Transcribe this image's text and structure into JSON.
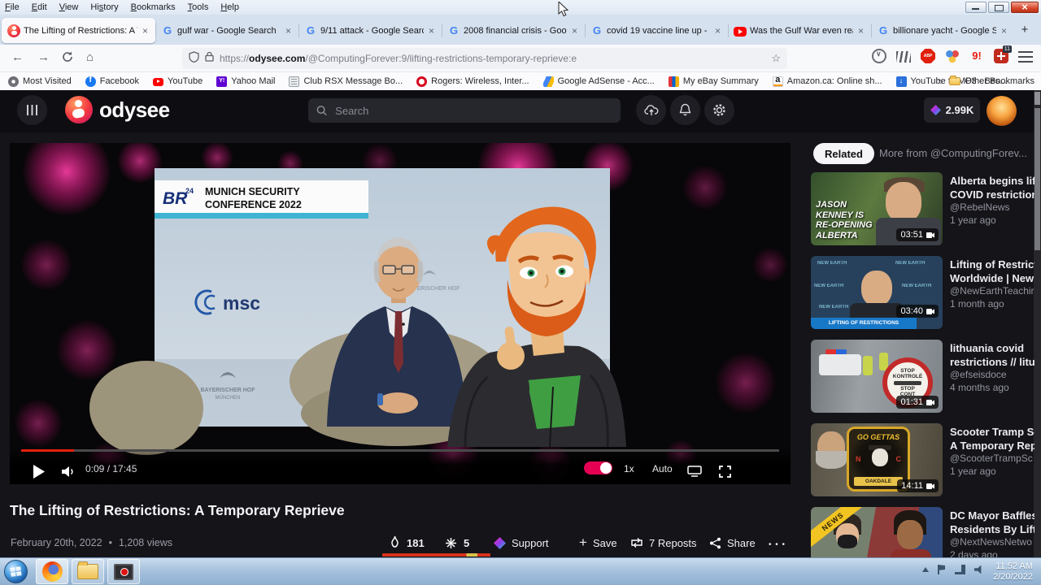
{
  "browser": {
    "menu": [
      {
        "label": "File",
        "ul": 0
      },
      {
        "label": "Edit",
        "ul": 0
      },
      {
        "label": "View",
        "ul": 0
      },
      {
        "label": "History",
        "ul": 2
      },
      {
        "label": "Bookmarks",
        "ul": 0
      },
      {
        "label": "Tools",
        "ul": 0
      },
      {
        "label": "Help",
        "ul": 0
      }
    ],
    "tabs": [
      {
        "title": "The Lifting of Restrictions: A T",
        "icon": "odysee",
        "active": true
      },
      {
        "title": "gulf war - Google Search",
        "icon": "google",
        "active": false
      },
      {
        "title": "9/11 attack - Google Search",
        "icon": "google",
        "active": false
      },
      {
        "title": "2008 financial crisis - Google",
        "icon": "google",
        "active": false
      },
      {
        "title": "covid 19 vaccine line up - Go",
        "icon": "google",
        "active": false
      },
      {
        "title": "Was the Gulf War even real?",
        "icon": "youtube",
        "active": false
      },
      {
        "title": "billionare yacht - Google Sea",
        "icon": "google",
        "active": false
      }
    ],
    "url": {
      "prefix": "https://",
      "host": "odysee.com",
      "path": "/@ComputingForever:9/lifting-restrictions-temporary-reprieve:e"
    },
    "bookmarks": [
      {
        "label": "Most Visited",
        "icon": "gear"
      },
      {
        "label": "Facebook",
        "icon": "facebook"
      },
      {
        "label": "YouTube",
        "icon": "youtube"
      },
      {
        "label": "Yahoo Mail",
        "icon": "yahoo"
      },
      {
        "label": "Club RSX Message Bo...",
        "icon": "page"
      },
      {
        "label": "Rogers: Wireless, Inter...",
        "icon": "rogers"
      },
      {
        "label": "Google AdSense - Acc...",
        "icon": "adsense"
      },
      {
        "label": "My eBay Summary",
        "icon": "ebay"
      },
      {
        "label": "Amazon.ca: Online sh...",
        "icon": "amazon"
      },
      {
        "label": "YouTube to MP3 - Bes...",
        "icon": "download"
      }
    ],
    "other_bookmarks": "Other Bookmarks",
    "ext_badge": "11"
  },
  "odysee": {
    "search_placeholder": "Search",
    "credits": "2.99K",
    "accent": "#e50054",
    "player": {
      "current": "0:09",
      "duration": "17:45",
      "speed": "1x",
      "quality": "Auto",
      "overlay": {
        "br": "BR",
        "br_sup": "24",
        "line1": "MUNICH SECURITY",
        "line2": "CONFERENCE 2022",
        "msc": "msc",
        "crest1": "BAYERISCHER HOF",
        "crest2": "MÜNCHEN"
      }
    },
    "video": {
      "title": "The Lifting of Restrictions: A Temporary Reprieve",
      "date": "February 20th, 2022",
      "views": "1,208 views",
      "likes": "181",
      "dislikes": "5",
      "support": "Support",
      "save": "Save",
      "reposts": "7 Reposts",
      "share": "Share"
    },
    "sidebar": {
      "related": "Related",
      "more": "More from @ComputingForev...",
      "videos": [
        {
          "line1": "Alberta begins lift",
          "line2": "COVID restrictions",
          "channel": "@RebelNews",
          "age": "1 year ago",
          "duration": "03:51",
          "thumb": {
            "t1": "JASON",
            "t2": "KENNEY IS",
            "t3": "RE-OPENING",
            "t4": "ALBERTA"
          }
        },
        {
          "line1": "Lifting of Restricti",
          "line2": "Worldwide | New I",
          "channel": "@NewEarthTeachir",
          "age": "1 month ago",
          "duration": "03:40",
          "thumb": {
            "banner": "LIFTING OF RESTRICTIONS",
            "wm": "NEW EARTH"
          }
        },
        {
          "line1": "lithuania covid",
          "line2": "restrictions // litua",
          "channel": "@efseisdoce",
          "age": "4 months ago",
          "duration": "01:31",
          "thumb": {
            "s1": "STOP",
            "s2": "KONTROLĖ",
            "s3": "STOP",
            "s4": "CONT"
          }
        },
        {
          "line1": "Scooter Tramp Sc",
          "line2": "A Temporary Repr",
          "channel": "@ScooterTrampSc",
          "age": "1 year ago",
          "duration": "14:11",
          "thumb": {
            "arc": "GO GETTAS",
            "l": "N",
            "r": "C",
            "ribbon": "OAKDALE"
          }
        },
        {
          "line1": "DC Mayor Baffles",
          "line2": "Residents By Liftin",
          "channel": "@NextNewsNetwo",
          "age": "2 days ago",
          "duration": "",
          "thumb": {
            "ribbon": "NEWS"
          }
        }
      ]
    }
  },
  "taskbar": {
    "time": "11:52 AM",
    "date": "2/20/2022"
  }
}
